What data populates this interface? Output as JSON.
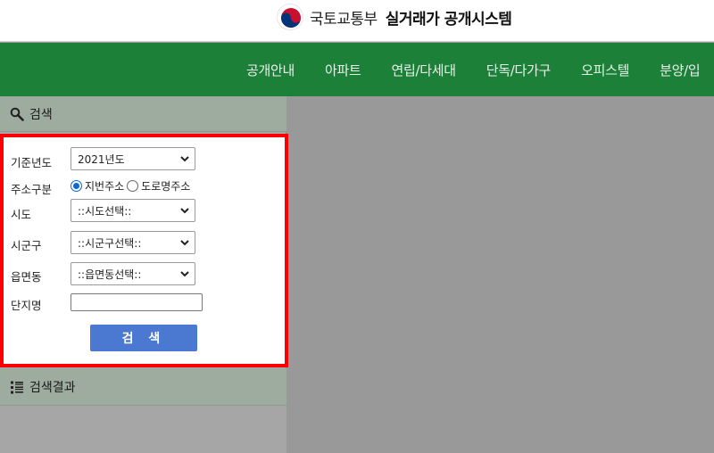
{
  "header": {
    "ministry_name": "국토교통부",
    "system_name": "실거래가 공개시스템"
  },
  "nav": {
    "items": [
      {
        "label": "공개안내"
      },
      {
        "label": "아파트"
      },
      {
        "label": "연립/다세대"
      },
      {
        "label": "단독/다가구"
      },
      {
        "label": "오피스텔"
      },
      {
        "label": "분양/입"
      }
    ]
  },
  "search_panel": {
    "title": "검색",
    "icon": "magnifier-icon",
    "fields": {
      "year": {
        "label": "기준년도",
        "value": "2021년도"
      },
      "address_type": {
        "label": "주소구분",
        "options": [
          {
            "label": "지번주소",
            "selected": true
          },
          {
            "label": "도로명주소",
            "selected": false
          }
        ]
      },
      "sido": {
        "label": "시도",
        "value": "::시도선택::"
      },
      "sigungu": {
        "label": "시군구",
        "value": "::시군구선택::"
      },
      "eupmyeondong": {
        "label": "읍면동",
        "value": "::읍면동선택::"
      },
      "complex_name": {
        "label": "단지명",
        "value": ""
      }
    },
    "submit_label": "검 색"
  },
  "results_panel": {
    "title": "검색결과",
    "icon": "list-icon"
  },
  "colors": {
    "nav_green": "#1d8039",
    "search_button": "#4b78d0",
    "highlight_border": "#ff0000"
  }
}
